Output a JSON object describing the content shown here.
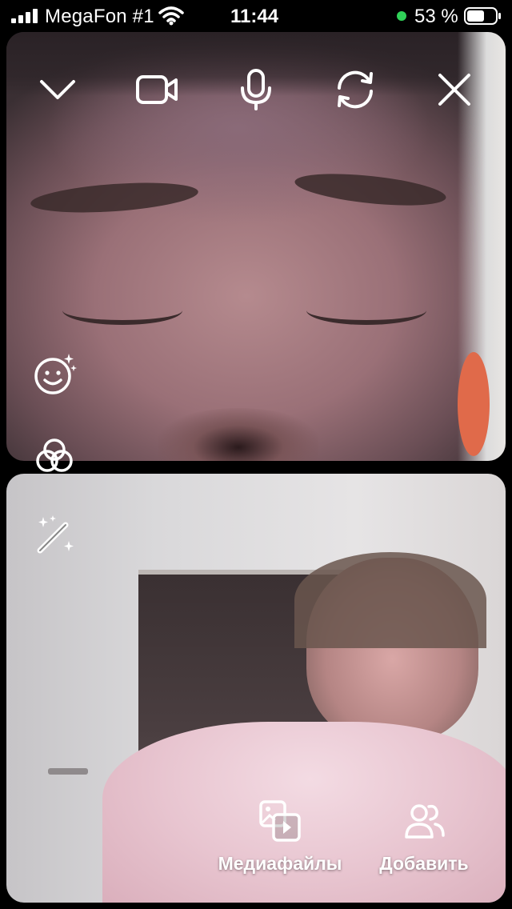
{
  "status_bar": {
    "carrier": "MegaFon #1",
    "time": "11:44",
    "battery_percent": "53 %",
    "camera_indicator_color": "#30d158",
    "icons": [
      "cellular-signal-icon",
      "wifi-icon",
      "battery-icon"
    ]
  },
  "call_controls": {
    "buttons": [
      "chevron-down-icon",
      "video-camera-icon",
      "microphone-icon",
      "camera-flip-icon",
      "close-icon"
    ]
  },
  "side_controls": {
    "buttons": [
      "face-effects-icon",
      "color-filters-icon",
      "magic-wand-icon"
    ]
  },
  "bottom_actions": {
    "media_label": "Медиафайлы",
    "add_label": "Добавить",
    "icons": [
      "media-files-icon",
      "add-people-icon"
    ]
  },
  "colors": {
    "background": "#000000",
    "icon_color": "#ffffff"
  }
}
